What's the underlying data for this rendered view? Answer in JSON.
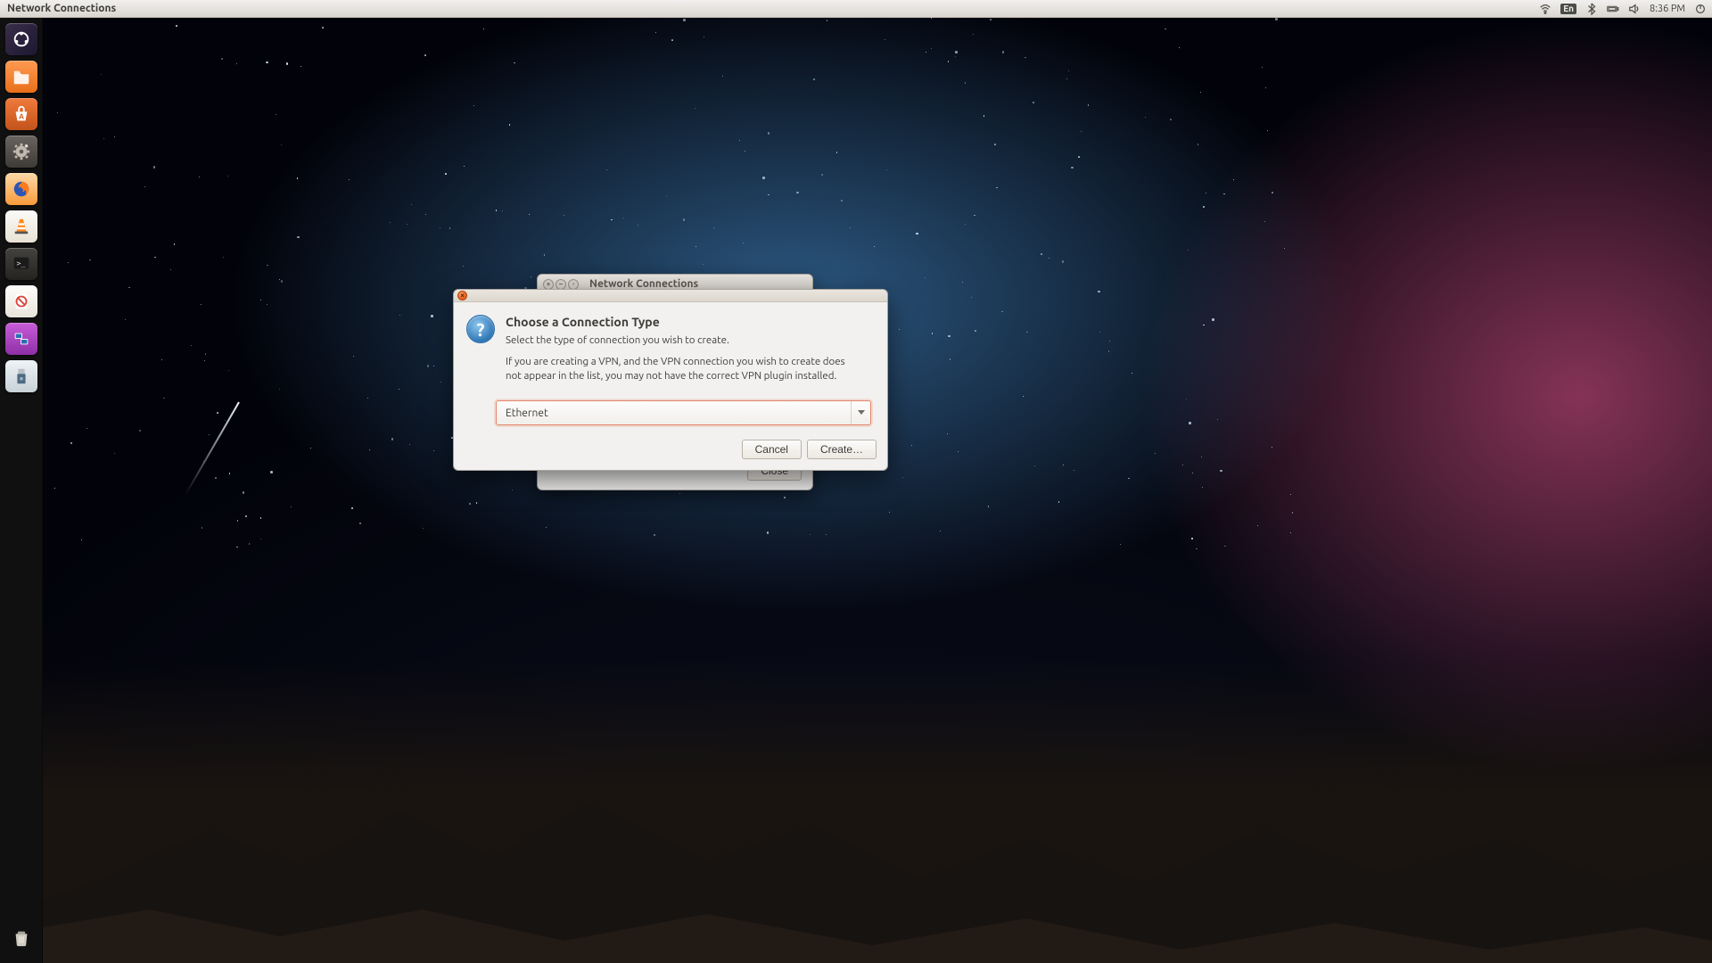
{
  "menubar": {
    "app_title": "Network Connections",
    "language": "En",
    "clock": "8:36 PM"
  },
  "launcher": {
    "items": [
      {
        "name": "dash",
        "bg": "linear-gradient(135deg,#3a2e4a,#1c1730)"
      },
      {
        "name": "files",
        "bg": "linear-gradient(to bottom,#ff9a52,#e86f1a)"
      },
      {
        "name": "software-center",
        "bg": "linear-gradient(to bottom,#f07a3c,#c2531b)"
      },
      {
        "name": "settings",
        "bg": "linear-gradient(to bottom,#6a6460,#3e3a36)"
      },
      {
        "name": "firefox",
        "bg": "linear-gradient(to bottom,#fdd9a8,#f79a3a)"
      },
      {
        "name": "vlc",
        "bg": "linear-gradient(to bottom,#fcfbf9,#e8e2d5)"
      },
      {
        "name": "terminal",
        "bg": "linear-gradient(to bottom,#454340,#25231f)"
      },
      {
        "name": "evince",
        "bg": "linear-gradient(to bottom,#fefefe,#e9e4da)"
      },
      {
        "name": "network-tool",
        "bg": "linear-gradient(to bottom,#c85dd9,#8e2fa6)"
      },
      {
        "name": "usb-creator",
        "bg": "linear-gradient(to bottom,#eef3f6,#c8d2d8)"
      }
    ],
    "trash_name": "trash"
  },
  "parent_window": {
    "title": "Network Connections",
    "close_label": "Close"
  },
  "dialog": {
    "heading": "Choose a Connection Type",
    "sub": "Select the type of connection you wish to create.",
    "note": "If you are creating a VPN, and the VPN connection you wish to create does not appear in the list, you may not have the correct VPN plugin installed.",
    "selected": "Ethernet",
    "cancel": "Cancel",
    "create": "Create…"
  }
}
